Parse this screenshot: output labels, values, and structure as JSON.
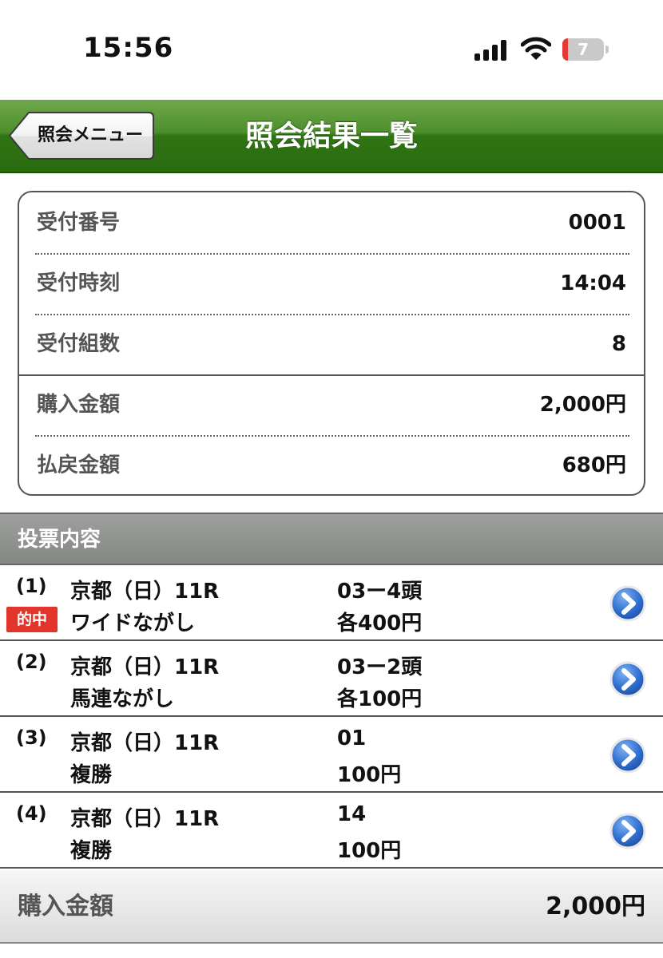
{
  "status_bar": {
    "time": "15:56",
    "battery_level": "7",
    "icons": [
      "signal-icon",
      "wifi-icon",
      "battery-icon"
    ]
  },
  "nav": {
    "back_label": "照会メニュー",
    "title": "照会結果一覧"
  },
  "receipt": {
    "rows": [
      {
        "label": "受付番号",
        "value": "0001"
      },
      {
        "label": "受付時刻",
        "value": "14:04"
      },
      {
        "label": "受付組数",
        "value": "8"
      },
      {
        "label": "購入金額",
        "value": "2,000円"
      },
      {
        "label": "払戻金額",
        "value": "680円"
      }
    ]
  },
  "section": {
    "title": "投票内容"
  },
  "bets": [
    {
      "num": "(1)",
      "badge": "的中",
      "race": "京都（日）11R",
      "type": "ワイドながし",
      "combo": "03ー4頭",
      "amount": "各400円"
    },
    {
      "num": "(2)",
      "badge": "",
      "race": "京都（日）11R",
      "type": "馬連ながし",
      "combo": "03ー2頭",
      "amount": "各100円"
    },
    {
      "num": "(3)",
      "badge": "",
      "race": "京都（日）11R",
      "type": "複勝",
      "combo": "01",
      "amount": "100円"
    },
    {
      "num": "(4)",
      "badge": "",
      "race": "京都（日）11R",
      "type": "複勝",
      "combo": "14",
      "amount": "100円"
    }
  ],
  "footer": {
    "label": "購入金額",
    "value": "2,000円"
  },
  "colors": {
    "nav_green": "#2f7414",
    "hit_red": "#e2352b",
    "detail_blue": "#2f6fd0",
    "section_gray": "#8e908d"
  }
}
